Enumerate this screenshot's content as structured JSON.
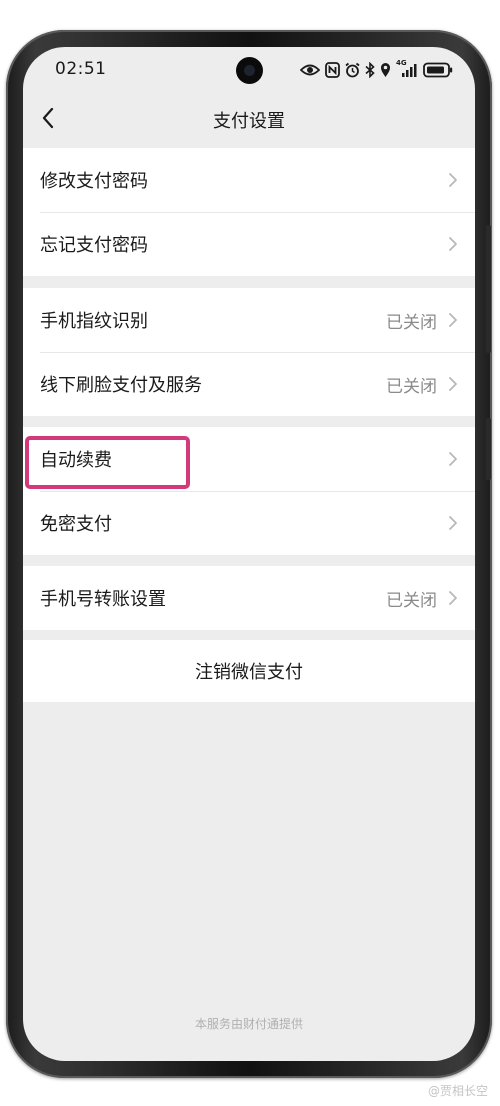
{
  "status_bar": {
    "time": "02:51",
    "network_label": "4G",
    "icons": [
      "eye-icon",
      "nfc-icon",
      "alarm-icon",
      "bluetooth-icon",
      "location-icon",
      "signal-icon",
      "battery-icon"
    ]
  },
  "nav": {
    "title": "支付设置",
    "back_icon": "chevron-left-icon"
  },
  "settings": {
    "groups": [
      {
        "items": [
          {
            "label": "修改支付密码",
            "value": ""
          },
          {
            "label": "忘记支付密码",
            "value": ""
          }
        ]
      },
      {
        "items": [
          {
            "label": "手机指纹识别",
            "value": "已关闭"
          },
          {
            "label": "线下刷脸支付及服务",
            "value": "已关闭"
          }
        ]
      },
      {
        "items": [
          {
            "label": "自动续费",
            "value": ""
          },
          {
            "label": "免密支付",
            "value": ""
          }
        ]
      },
      {
        "items": [
          {
            "label": "手机号转账设置",
            "value": "已关闭"
          }
        ]
      }
    ]
  },
  "logout_label": "注销微信支付",
  "footer_text": "本服务由财付通提供",
  "watermark_text": "@贾相长空",
  "colors": {
    "screen_background": "#ededed",
    "highlight_border": "#d23a7c",
    "secondary_text": "#8a8a8a"
  }
}
